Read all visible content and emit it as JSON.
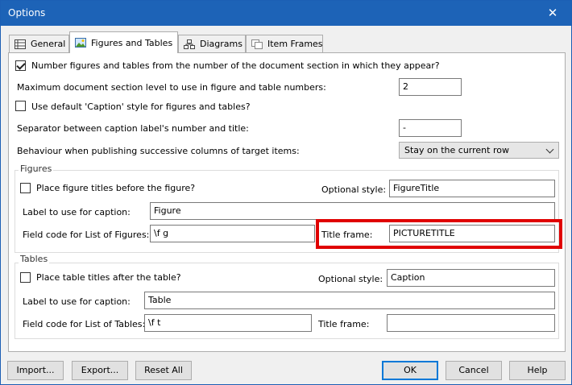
{
  "window": {
    "title": "Options",
    "close_glyph": "✕"
  },
  "tabs": [
    {
      "label": "General",
      "icon": "grid-icon"
    },
    {
      "label": "Figures and Tables",
      "icon": "image-icon",
      "active": true
    },
    {
      "label": "Diagrams",
      "icon": "diagram-icon"
    },
    {
      "label": "Item Frames",
      "icon": "frames-icon"
    }
  ],
  "general": {
    "number_by_section": {
      "label": "Number figures and tables from the number of the document section in which they appear?",
      "checked": true
    },
    "max_section_level": {
      "label": "Maximum document section level to use in figure and table numbers:",
      "value": "2"
    },
    "default_caption": {
      "label": "Use default 'Caption' style for figures and tables?",
      "checked": false
    },
    "separator": {
      "label": "Separator between caption label's number and title:",
      "value": "-"
    },
    "behaviour": {
      "label": "Behaviour when publishing successive columns of target items:",
      "value": "Stay on the current row"
    }
  },
  "figures": {
    "group_title": "Figures",
    "before": {
      "label": "Place figure titles before the figure?",
      "checked": false
    },
    "optional_style": {
      "label": "Optional style:",
      "value": "FigureTitle"
    },
    "caption_label": {
      "label": "Label to use for caption:",
      "value": "Figure"
    },
    "field_code": {
      "label": "Field code for List of Figures:",
      "value": "\\f g"
    },
    "title_frame": {
      "label": "Title frame:",
      "value": "PICTURETITLE"
    }
  },
  "tables": {
    "group_title": "Tables",
    "after": {
      "label": "Place table titles after the table?",
      "checked": false
    },
    "optional_style": {
      "label": "Optional style:",
      "value": "Caption"
    },
    "caption_label": {
      "label": "Label to use for caption:",
      "value": "Table"
    },
    "field_code": {
      "label": "Field code for List of Tables:",
      "value": "\\f t"
    },
    "title_frame": {
      "label": "Title frame:",
      "value": ""
    }
  },
  "buttons": {
    "import": "Import...",
    "export": "Export...",
    "reset": "Reset All",
    "ok": "OK",
    "cancel": "Cancel",
    "help": "Help"
  },
  "colors": {
    "titlebar": "#1d63b7",
    "highlight": "#e00000",
    "default_button": "#0078d7"
  }
}
